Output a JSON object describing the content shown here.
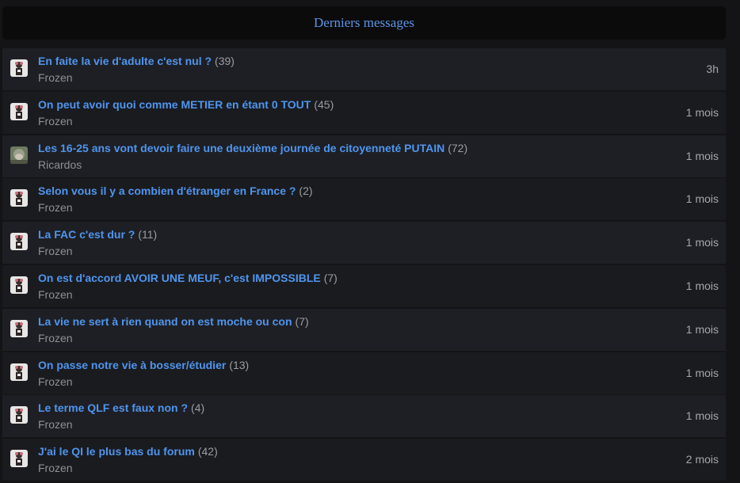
{
  "header": {
    "title": "Derniers messages"
  },
  "topics": [
    {
      "title": "En faite la vie d'adulte c'est nul ?",
      "count": "(39)",
      "author": "Frozen",
      "time": "3h",
      "avatar": "frozen-avatar"
    },
    {
      "title": "On peut avoir quoi comme METIER en étant 0 TOUT",
      "count": "(45)",
      "author": "Frozen",
      "time": "1 mois",
      "avatar": "frozen-avatar"
    },
    {
      "title": "Les 16-25 ans vont devoir faire une deuxième journée de citoyenneté PUTAIN",
      "count": "(72)",
      "author": "Ricardos",
      "time": "1 mois",
      "avatar": "ricardos-avatar"
    },
    {
      "title": "Selon vous il y a combien d'étranger en France ?",
      "count": "(2)",
      "author": "Frozen",
      "time": "1 mois",
      "avatar": "frozen-avatar"
    },
    {
      "title": "La FAC c'est dur ?",
      "count": "(11)",
      "author": "Frozen",
      "time": "1 mois",
      "avatar": "frozen-avatar"
    },
    {
      "title": "On est d'accord AVOIR UNE MEUF, c'est IMPOSSIBLE",
      "count": "(7)",
      "author": "Frozen",
      "time": "1 mois",
      "avatar": "frozen-avatar"
    },
    {
      "title": "La vie ne sert à rien quand on est moche ou con",
      "count": "(7)",
      "author": "Frozen",
      "time": "1 mois",
      "avatar": "frozen-avatar"
    },
    {
      "title": "On passe notre vie à bosser/étudier",
      "count": "(13)",
      "author": "Frozen",
      "time": "1 mois",
      "avatar": "frozen-avatar"
    },
    {
      "title": "Le terme QLF est faux non ?",
      "count": "(4)",
      "author": "Frozen",
      "time": "1 mois",
      "avatar": "frozen-avatar"
    },
    {
      "title": "J'ai le QI le plus bas du forum",
      "count": "(42)",
      "author": "Frozen",
      "time": "2 mois",
      "avatar": "frozen-avatar"
    }
  ],
  "colors": {
    "background": "#141416",
    "header_bg": "#0b0b0c",
    "row_bg": "#1e1f24",
    "row_bg_alt": "#1a1b1f",
    "link": "#4f95ee",
    "muted": "#8d9097"
  }
}
